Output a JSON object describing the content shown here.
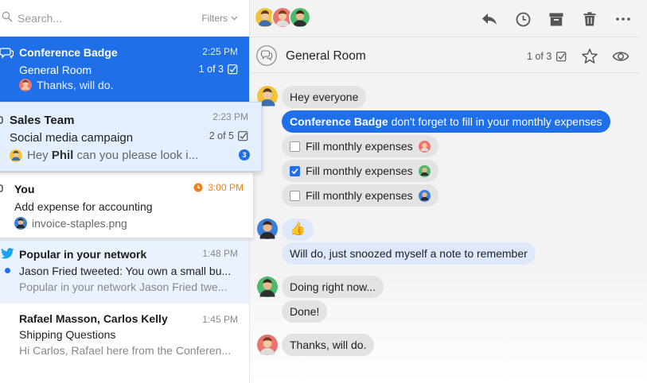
{
  "search": {
    "placeholder": "Search...",
    "filters_label": "Filters"
  },
  "conversations": [
    {
      "title": "Conference Badge",
      "time": "2:25 PM",
      "subtitle": "General Room",
      "count": "1 of 3",
      "preview": "Thanks, will do."
    },
    {
      "title": "Sales Team",
      "time": "2:23 PM",
      "subtitle": "Social media campaign",
      "count": "2 of 5",
      "preview_prefix": "Hey ",
      "preview_bold": "Phil",
      "preview_rest": " can you please look i...",
      "badge": "3"
    },
    {
      "title": "You",
      "time": "3:00 PM",
      "subtitle": "Add expense for accounting",
      "preview": "invoice-staples.png"
    },
    {
      "title": "Popular in your network",
      "time": "1:48 PM",
      "subtitle": "Jason Fried tweeted: You own a small bu...",
      "preview": "Popular in your network Jason Fried twe..."
    },
    {
      "title": "Rafael Masson, Carlos Kelly",
      "time": "1:45 PM",
      "subtitle": "Shipping Questions",
      "preview": "Hi Carlos, Rafael here from the Conferen..."
    }
  ],
  "room": {
    "name": "General Room",
    "pager": "1 of 3"
  },
  "messages": {
    "m1": "Hey everyone",
    "m2_bold": "Conference Badge",
    "m2_rest": " don't forget to fill in your monthly expenses",
    "tasks": [
      {
        "label": "Fill monthly expenses",
        "checked": false
      },
      {
        "label": "Fill monthly expenses",
        "checked": true
      },
      {
        "label": "Fill monthly expenses",
        "checked": false
      }
    ],
    "m3": "👍",
    "m4": "Will do, just snoozed myself a note to remember",
    "m5": "Doing right now...",
    "m6": "Done!",
    "m7": "Thanks, will do."
  },
  "icons": {
    "search": "search-icon",
    "chevron": "chevron-down-icon",
    "chat": "chat-bubbles-icon",
    "twitter": "twitter-icon",
    "check": "check-square-icon",
    "clock": "clock-icon",
    "reply": "reply-icon",
    "archive": "archive-icon",
    "trash": "trash-icon",
    "more": "more-horizontal-icon",
    "star": "star-icon",
    "eye": "eye-icon"
  },
  "colors": {
    "accent": "#1f6fe8",
    "snooze": "#f07f1a",
    "bubble": "#e3e3e4",
    "selected_bg": "#e4effd"
  }
}
